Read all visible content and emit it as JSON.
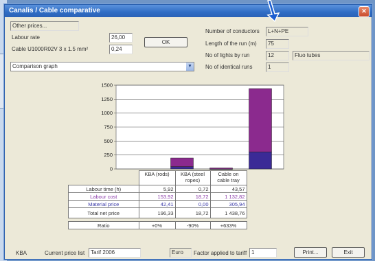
{
  "window": {
    "title": "Canalis / Cable comparative"
  },
  "prices": {
    "other_prices_label": "Other prices...",
    "labour_rate_label": "Labour rate",
    "labour_rate_value": "26,00",
    "cable_label": "Cable U1000R02V  3 x 1.5 mm²",
    "cable_value": "0,24",
    "ok_label": "OK"
  },
  "display_select": {
    "value": "Comparison graph"
  },
  "run": {
    "conductors_label": "Number of conductors",
    "conductors_value": "L+N+PE",
    "length_label": "Length of the run (m)",
    "length_value": "75",
    "lights_label": "No of lights by run",
    "lights_value": "12",
    "lights_type": "Fluo tubes",
    "runs_label": "No of identical runs",
    "runs_value": "1"
  },
  "chart_data": {
    "type": "bar",
    "stacked": true,
    "categories": [
      "KBA (rods)",
      "KBA (steel ropes)",
      "Cable on cable tray"
    ],
    "series": [
      {
        "values": [
          153.92,
          18.72,
          1132.82
        ],
        "color": "#8b2a8e"
      },
      {
        "values": [
          42.41,
          0.0,
          305.94
        ],
        "color": "#3b2a96"
      }
    ],
    "y_ticks": [
      "0",
      "250",
      "500",
      "750",
      "1000",
      "1250",
      "1500"
    ],
    "ylim": [
      0,
      1500
    ],
    "grid": true
  },
  "table": {
    "headers": [
      "KBA (rods)",
      "KBA (steel ropes)",
      "Cable on cable tray"
    ],
    "rows": [
      {
        "label": "Labour time (h)",
        "values": [
          "5,92",
          "0,72",
          "43,57"
        ]
      },
      {
        "label": "Labour cost",
        "values": [
          "153,92",
          "18,72",
          "1 132,82"
        ]
      },
      {
        "label": "Material price",
        "values": [
          "42,41",
          "0,00",
          "305,94"
        ]
      },
      {
        "label": "Total net price",
        "values": [
          "196,33",
          "18,72",
          "1 438,76"
        ]
      }
    ],
    "ratio": {
      "label": "Ratio",
      "values": [
        "+0%",
        "-90%",
        "+633%"
      ]
    }
  },
  "footer": {
    "product": "KBA",
    "price_list_label": "Current price list",
    "price_list_value": "Tarif 2006",
    "currency": "Euro",
    "factor_label": "Factor applied to tariff",
    "factor_value": "1",
    "print_label": "Print...",
    "exit_label": "Exit"
  }
}
